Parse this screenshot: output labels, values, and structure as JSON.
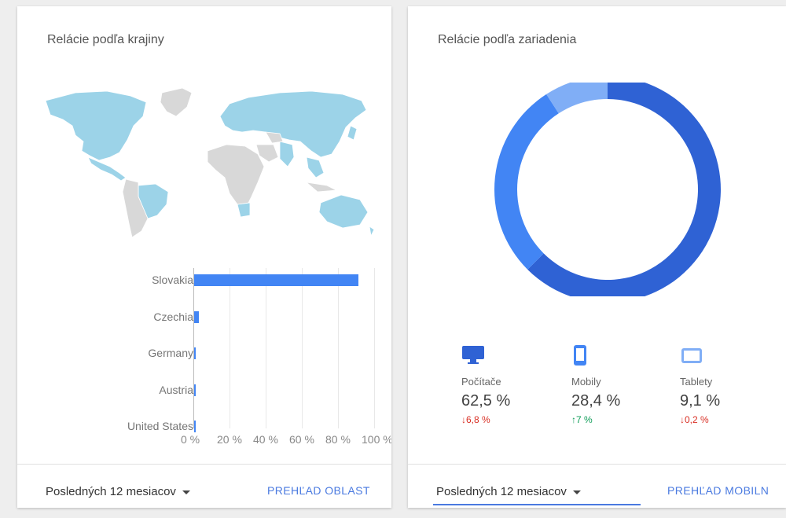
{
  "country_card": {
    "title": "Relácie podľa krajiny",
    "date_range": "Posledných 12 mesiacov",
    "report_link": "PREHĽAD OBLAST",
    "map_colors": {
      "active": "#9cd3e8",
      "inactive": "#d8d8d8"
    }
  },
  "device_card": {
    "title": "Relácie podľa zariadenia",
    "date_range": "Posledných 12 mesiacov",
    "report_link": "PREHĽAD MOBILN",
    "devices": [
      {
        "icon": "desktop-icon",
        "label": "Počítače",
        "value": "62,5 %",
        "change": "6,8 %",
        "direction": "down",
        "color": "#2f62d4"
      },
      {
        "icon": "mobile-icon",
        "label": "Mobily",
        "value": "28,4 %",
        "change": "7 %",
        "direction": "up",
        "color": "#4285f4"
      },
      {
        "icon": "tablet-icon",
        "label": "Tablety",
        "value": "9,1 %",
        "change": "0,2 %",
        "direction": "down",
        "color": "#80aef6"
      }
    ]
  },
  "chart_data": [
    {
      "type": "bar",
      "orientation": "horizontal",
      "categories": [
        "Slovakia",
        "Czechia",
        "Germany",
        "Austria",
        "United States"
      ],
      "values": [
        91,
        2.5,
        0.5,
        0.5,
        0.4
      ],
      "xticks": [
        "0 %",
        "20 %",
        "40 %",
        "60 %",
        "80 %",
        "100 %"
      ],
      "xlim": [
        0,
        100
      ],
      "color": "#4285f4",
      "grid": true
    },
    {
      "type": "pie",
      "donut": true,
      "categories": [
        "Počítače",
        "Mobily",
        "Tablety"
      ],
      "values": [
        62.5,
        28.4,
        9.1
      ],
      "colors": [
        "#2f62d4",
        "#4285f4",
        "#80aef6"
      ]
    }
  ]
}
